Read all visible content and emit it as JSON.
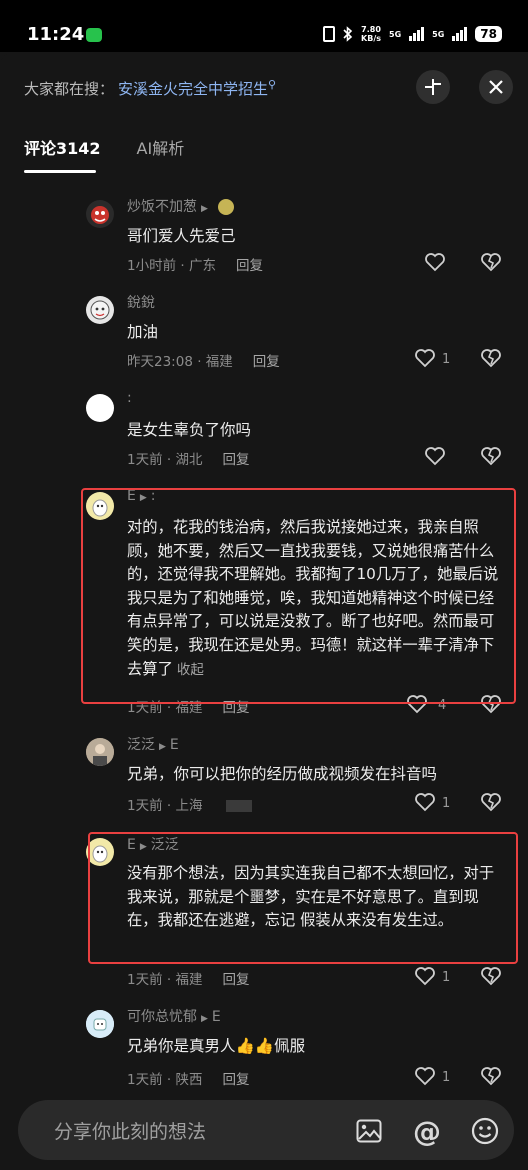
{
  "status": {
    "time": "11:24",
    "net_speed_value": "7.80",
    "net_speed_unit": "KB/s",
    "sim1": "5G",
    "sim2": "5G",
    "battery": "78"
  },
  "header": {
    "search_prefix": "大家都在搜：",
    "search_term": "安溪金火完全中学招生",
    "tabs": [
      {
        "label": "评论3142",
        "active": true
      },
      {
        "label": "AI解析",
        "active": false
      }
    ]
  },
  "comments": [
    {
      "user": "炒饭不加葱",
      "reply_to": "",
      "text": "哥们爱人先爱己",
      "time": "1小时前 · 广东",
      "reply": "回复",
      "likes": "",
      "collapse": ""
    },
    {
      "user": "銳銳",
      "reply_to": "",
      "text": "加油",
      "time": "昨天23:08 · 福建",
      "reply": "回复",
      "likes": "1",
      "collapse": ""
    },
    {
      "user": ":",
      "reply_to": "",
      "text": "是女生辜负了你吗",
      "time": "1天前 · 湖北",
      "reply": "回复",
      "likes": "",
      "collapse": ""
    },
    {
      "user": "E",
      "reply_to": ":",
      "text": "对的，花我的钱治病，然后我说接她过来，我亲自照顾，她不要，然后又一直找我要钱，又说她很痛苦什么的，还觉得我不理解她。我都掏了10几万了，她最后说我只是为了和她睡觉，唉，我知道她精神这个时候已经有点异常了，可以说是没救了。断了也好吧。然而最可笑的是，我现在还是处男。玛德！就这样一辈子清净下去算了",
      "time": "1天前 · 福建",
      "reply": "回复",
      "likes": "4",
      "collapse": "收起"
    },
    {
      "user": "泛泛",
      "reply_to": "E",
      "text": "兄弟，你可以把你的经历做成视频发在抖音吗",
      "time": "1天前 · 上海",
      "reply": "",
      "likes": "1",
      "collapse": ""
    },
    {
      "user": "E",
      "reply_to": "泛泛",
      "text": "没有那个想法，因为其实连我自己都不太想回忆，对于我来说，那就是个噩梦，实在是不好意思了。直到现在，我都还在逃避，忘记 假装从来没有发生过。",
      "time": "1天前 · 福建",
      "reply": "回复",
      "likes": "1",
      "collapse": ""
    },
    {
      "user": "可你总忧郁",
      "reply_to": "E",
      "text": "兄弟你是真男人👍👍佩服",
      "time": "1天前 · 陕西",
      "reply": "回复",
      "likes": "1",
      "collapse": ""
    }
  ],
  "input": {
    "placeholder": "分享你此刻的想法"
  },
  "colors": {
    "highlight": "#e94040",
    "search_term": "#8fb6f2",
    "background": "#161616"
  }
}
